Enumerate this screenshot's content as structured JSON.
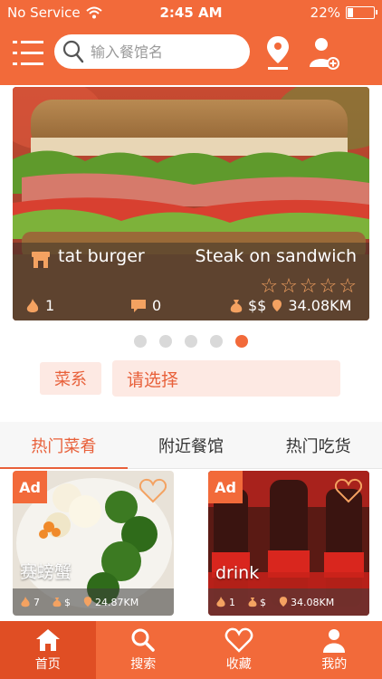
{
  "status_bar": {
    "carrier": "No Service",
    "time": "2:45 AM",
    "battery_percent": "22%",
    "battery_level": 0.22
  },
  "header": {
    "search_placeholder": "输入餐馆名"
  },
  "banner": {
    "restaurant": "tat burger",
    "dish": "Steak on sandwich",
    "rating_stars": 0,
    "rating_max": 5,
    "likes": "1",
    "comments": "0",
    "price": "$$",
    "distance": "34.08KM",
    "slide_count": 5,
    "active_slide": 5
  },
  "filter": {
    "label": "菜系",
    "value": "请选择"
  },
  "tabs": [
    {
      "label": "热门菜肴",
      "active": true
    },
    {
      "label": "附近餐馆",
      "active": false
    },
    {
      "label": "热门吃货",
      "active": false
    }
  ],
  "cards": [
    {
      "ad": "Ad",
      "name": "赛螃蟹",
      "likes": "7",
      "price": "$",
      "distance": "24.87KM"
    },
    {
      "ad": "Ad",
      "name": "drink",
      "likes": "1",
      "price": "$",
      "distance": "34.08KM"
    }
  ],
  "tabbar": [
    {
      "label": "首页",
      "icon": "home-icon",
      "active": true
    },
    {
      "label": "搜索",
      "icon": "search-icon",
      "active": false
    },
    {
      "label": "收藏",
      "icon": "heart-icon",
      "active": false
    },
    {
      "label": "我的",
      "icon": "person-icon",
      "active": false
    }
  ],
  "colors": {
    "accent": "#f26a3a",
    "accent_light": "#fde9e3",
    "tab_active_bg": "#e04e24"
  }
}
